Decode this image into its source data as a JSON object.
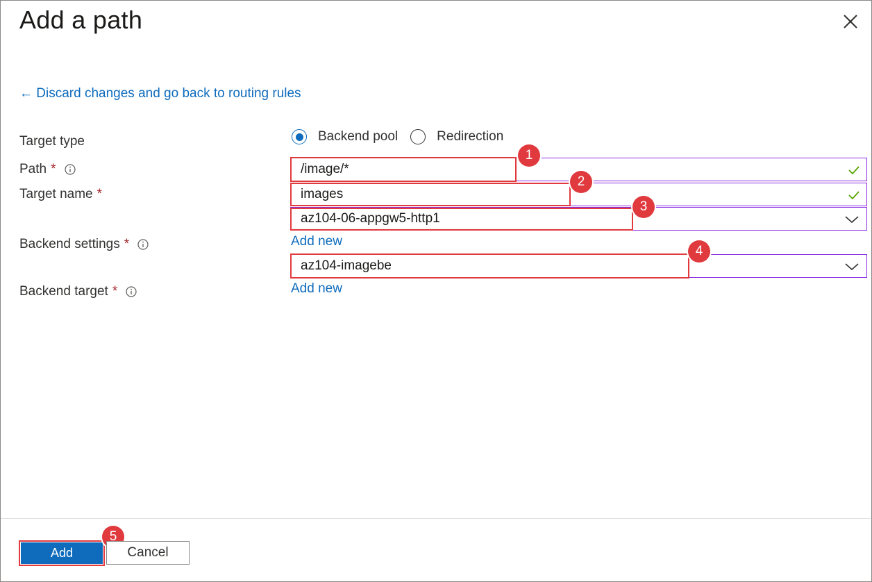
{
  "dialog": {
    "title": "Add a path",
    "back_link": "← Discard changes and go back to routing rules"
  },
  "form": {
    "target_type": {
      "label": "Target type",
      "options": [
        "Backend pool",
        "Redirection"
      ],
      "selected": "Backend pool"
    },
    "path": {
      "label": "Path",
      "required_mark": "*",
      "value": "/image/*"
    },
    "target_name": {
      "label": "Target name",
      "required_mark": "*",
      "value": "images"
    },
    "backend_settings": {
      "label": "Backend settings",
      "required_mark": "*",
      "value": "az104-06-appgw5-http1",
      "add_new": "Add new"
    },
    "backend_target": {
      "label": "Backend target",
      "required_mark": "*",
      "value": "az104-imagebe",
      "add_new": "Add new"
    }
  },
  "annotations": [
    "1",
    "2",
    "3",
    "4",
    "5"
  ],
  "footer": {
    "add_label": "Add",
    "cancel_label": "Cancel"
  },
  "colors": {
    "accent": "#0f6cbd",
    "highlight": "#e0393e",
    "valid": "#57a300",
    "required": "#a4262c"
  }
}
